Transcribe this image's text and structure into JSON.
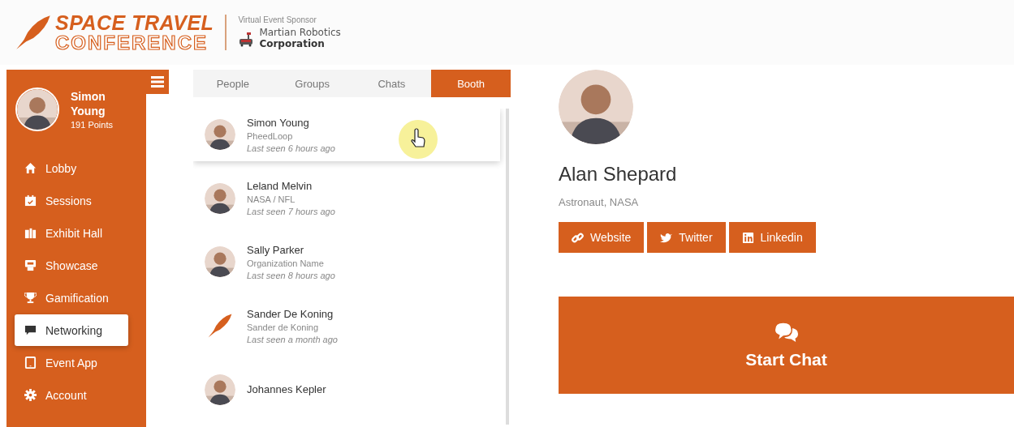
{
  "header": {
    "logo_line_1": "SPACE TRAVEL",
    "logo_line_2": "CONFERENCE",
    "sponsor_label": "Virtual Event Sponsor",
    "sponsor_name_1": "Martian Robotics",
    "sponsor_name_2": "Corporation"
  },
  "sidebar": {
    "user": {
      "first_name": "Simon",
      "last_name": "Young",
      "points": "191 Points"
    },
    "items": [
      {
        "label": "Lobby",
        "selected": false
      },
      {
        "label": "Sessions",
        "selected": false
      },
      {
        "label": "Exhibit Hall",
        "selected": false
      },
      {
        "label": "Showcase",
        "selected": false
      },
      {
        "label": "Gamification",
        "selected": false
      },
      {
        "label": "Networking",
        "selected": true
      },
      {
        "label": "Event App",
        "selected": false
      },
      {
        "label": "Account",
        "selected": false
      }
    ]
  },
  "tabs": [
    {
      "label": "People",
      "selected": false
    },
    {
      "label": "Groups",
      "selected": false
    },
    {
      "label": "Chats",
      "selected": false
    },
    {
      "label": "Booth",
      "selected": true
    }
  ],
  "people": [
    {
      "name": "Simon Young",
      "org": "PheedLoop",
      "last_seen": "Last seen 6 hours ago",
      "selected": true
    },
    {
      "name": "Leland Melvin",
      "org": "NASA / NFL",
      "last_seen": "Last seen 7 hours ago",
      "selected": false
    },
    {
      "name": "Sally Parker",
      "org": "Organization Name",
      "last_seen": "Last seen 8 hours ago",
      "selected": false
    },
    {
      "name": "Sander De Koning",
      "org": "Sander de Koning",
      "last_seen": "Last seen a month ago",
      "kind": "logo",
      "selected": false
    },
    {
      "name": "Johannes Kepler",
      "selected": false
    }
  ],
  "profile": {
    "name": "Alan Shepard",
    "title": "Astronaut, NASA",
    "links": [
      {
        "label": "Website"
      },
      {
        "label": "Twitter"
      },
      {
        "label": "Linkedin"
      }
    ],
    "start_chat": "Start Chat"
  }
}
